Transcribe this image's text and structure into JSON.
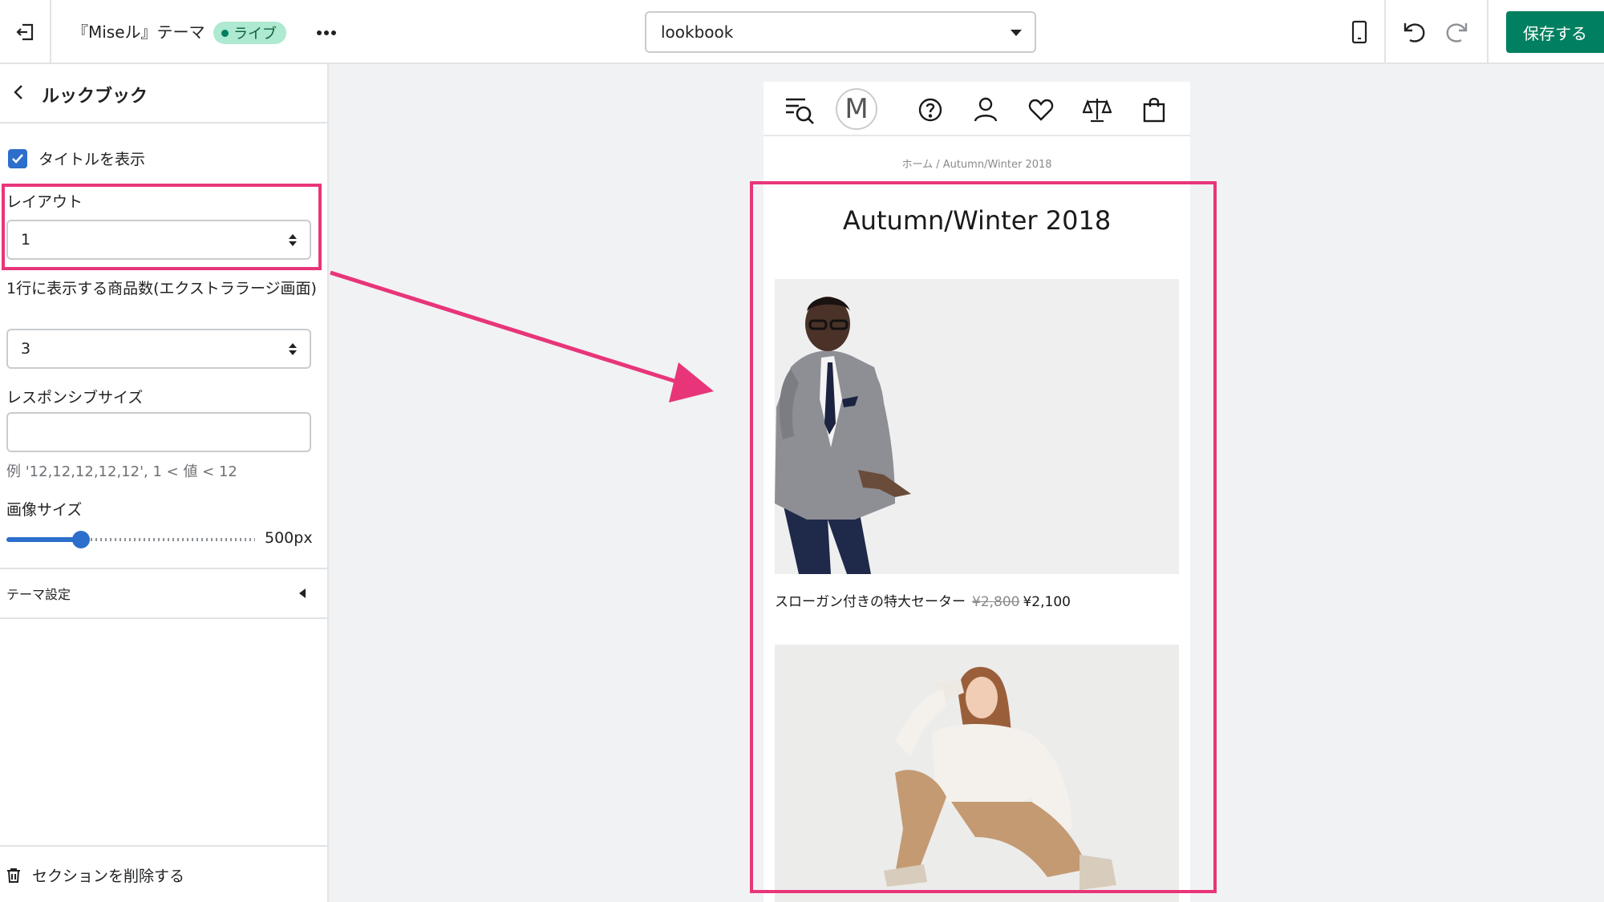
{
  "topbar": {
    "theme_name": "『Miseル』テーマ",
    "live_label": "ライブ",
    "page_select_value": "lookbook",
    "save_label": "保存する"
  },
  "sidebar": {
    "title": "ルックブック",
    "show_title": {
      "label": "タイトルを表示",
      "checked": true
    },
    "layout": {
      "label": "レイアウト",
      "value": "1"
    },
    "products_per_row": {
      "label": "1行に表示する商品数(エクストララージ画面)",
      "value": "3"
    },
    "responsive_size": {
      "label": "レスポンシブサイズ",
      "value": "",
      "help": "例 '12,12,12,12,12', 1 < 値 < 12"
    },
    "image_size": {
      "label": "画像サイズ",
      "value_text": "500px",
      "level": 0.3
    },
    "theme_settings_label": "テーマ設定",
    "delete_label": "セクションを削除する"
  },
  "preview": {
    "logo_letter": "M",
    "breadcrumb": "ホーム / Autumn/Winter 2018",
    "title": "Autumn/Winter 2018",
    "products": [
      {
        "name": "スローガン付きの特大セーター",
        "price_old": "¥2,800",
        "price_new": "¥2,100"
      }
    ]
  },
  "colors": {
    "accent": "#008060",
    "highlight": "#e8357a",
    "selection_blue": "#2c6ecb",
    "live_badge": "#aee9d1"
  },
  "icons": [
    "exit-icon",
    "more-icon",
    "chevron-down-icon",
    "mobile-device-icon",
    "undo-icon",
    "redo-icon",
    "chevron-left-icon",
    "checkmark-icon",
    "trash-icon",
    "menu-search-icon",
    "help-icon",
    "account-icon",
    "heart-icon",
    "compare-icon",
    "bag-icon"
  ]
}
